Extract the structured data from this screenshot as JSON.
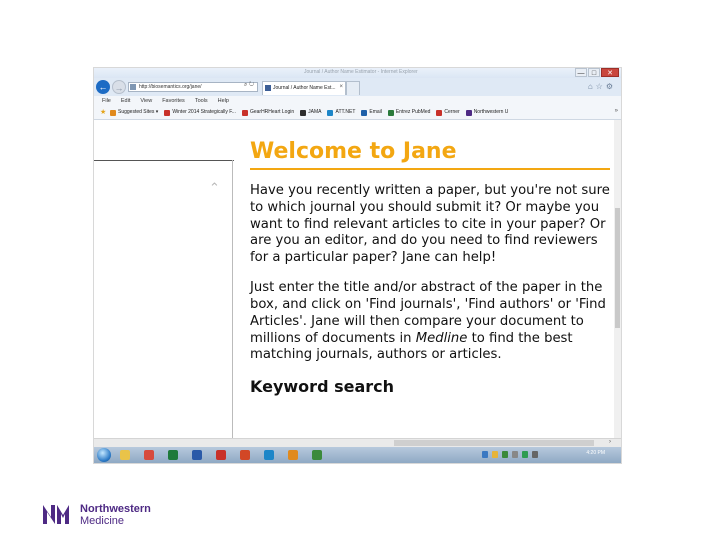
{
  "browser": {
    "window_title": "Journal / Author Name Estimator - Internet Explorer",
    "url": "http://biosemantics.org/jane/",
    "tab_label": "Journal / Author Name Est...",
    "tab_close": "×",
    "window_buttons": {
      "minimize": "—",
      "maximize": "□",
      "close": "✕"
    },
    "menu": [
      "File",
      "Edit",
      "View",
      "Favorites",
      "Tools",
      "Help"
    ],
    "favorites": [
      {
        "label": "Suggested Sites ▾",
        "icon": "suggested-sites-icon",
        "color": "#e08a1e"
      },
      {
        "label": "Winter 2014 Strategically F...",
        "icon": "bookmark-icon",
        "color": "#c8312a"
      },
      {
        "label": "GearHRHeart Login",
        "icon": "heart-icon",
        "color": "#c8312a"
      },
      {
        "label": "JAMA",
        "icon": "jama-icon",
        "color": "#2e2e2e"
      },
      {
        "label": "ATT.NET",
        "icon": "att-icon",
        "color": "#1d86c8"
      },
      {
        "label": "Email",
        "icon": "email-icon",
        "color": "#1d5fa8"
      },
      {
        "label": "Entrez PubMed",
        "icon": "pubmed-icon",
        "color": "#2a7a3b"
      },
      {
        "label": "Cerner",
        "icon": "cerner-icon",
        "color": "#c8312a"
      },
      {
        "label": "Northwestern U",
        "icon": "northwestern-icon",
        "color": "#4e2a84"
      }
    ],
    "favorites_more": "»"
  },
  "page": {
    "heading": "Welcome to Jane",
    "para1": "Have you recently written a paper, but you're not sure to which journal you should submit it? Or maybe you want to find relevant articles to cite in your paper? Or are you an editor, and do you need to find reviewers for a particular paper? Jane can help!",
    "para2_before": "Just enter the title and/or abstract of the paper in the box, and click on 'Find journals', 'Find authors' or 'Find Articles'. Jane will then compare your document to millions of documents in ",
    "para2_em": "Medline",
    "para2_after": " to find the best matching journals, authors or articles.",
    "keyword_search": "Keyword search"
  },
  "taskbar": {
    "clock": "4:20 PM",
    "apps": [
      {
        "icon": "explorer-icon",
        "color": "#e9c349"
      },
      {
        "icon": "chrome-icon",
        "color": "#d74b3d"
      },
      {
        "icon": "excel-icon",
        "color": "#1f7a3a"
      },
      {
        "icon": "word-icon",
        "color": "#2a5aa8"
      },
      {
        "icon": "acrobat-icon",
        "color": "#c8312a"
      },
      {
        "icon": "powerpoint-icon",
        "color": "#d24726"
      },
      {
        "icon": "ie-icon",
        "color": "#1d86c8"
      },
      {
        "icon": "paint-icon",
        "color": "#e08a1e"
      },
      {
        "icon": "project-icon",
        "color": "#3b8a3b"
      }
    ]
  },
  "logo": {
    "line1": "Northwestern",
    "line2": "Medicine"
  },
  "colors": {
    "heading": "#f3a712",
    "brand_purple": "#4e2a84"
  }
}
